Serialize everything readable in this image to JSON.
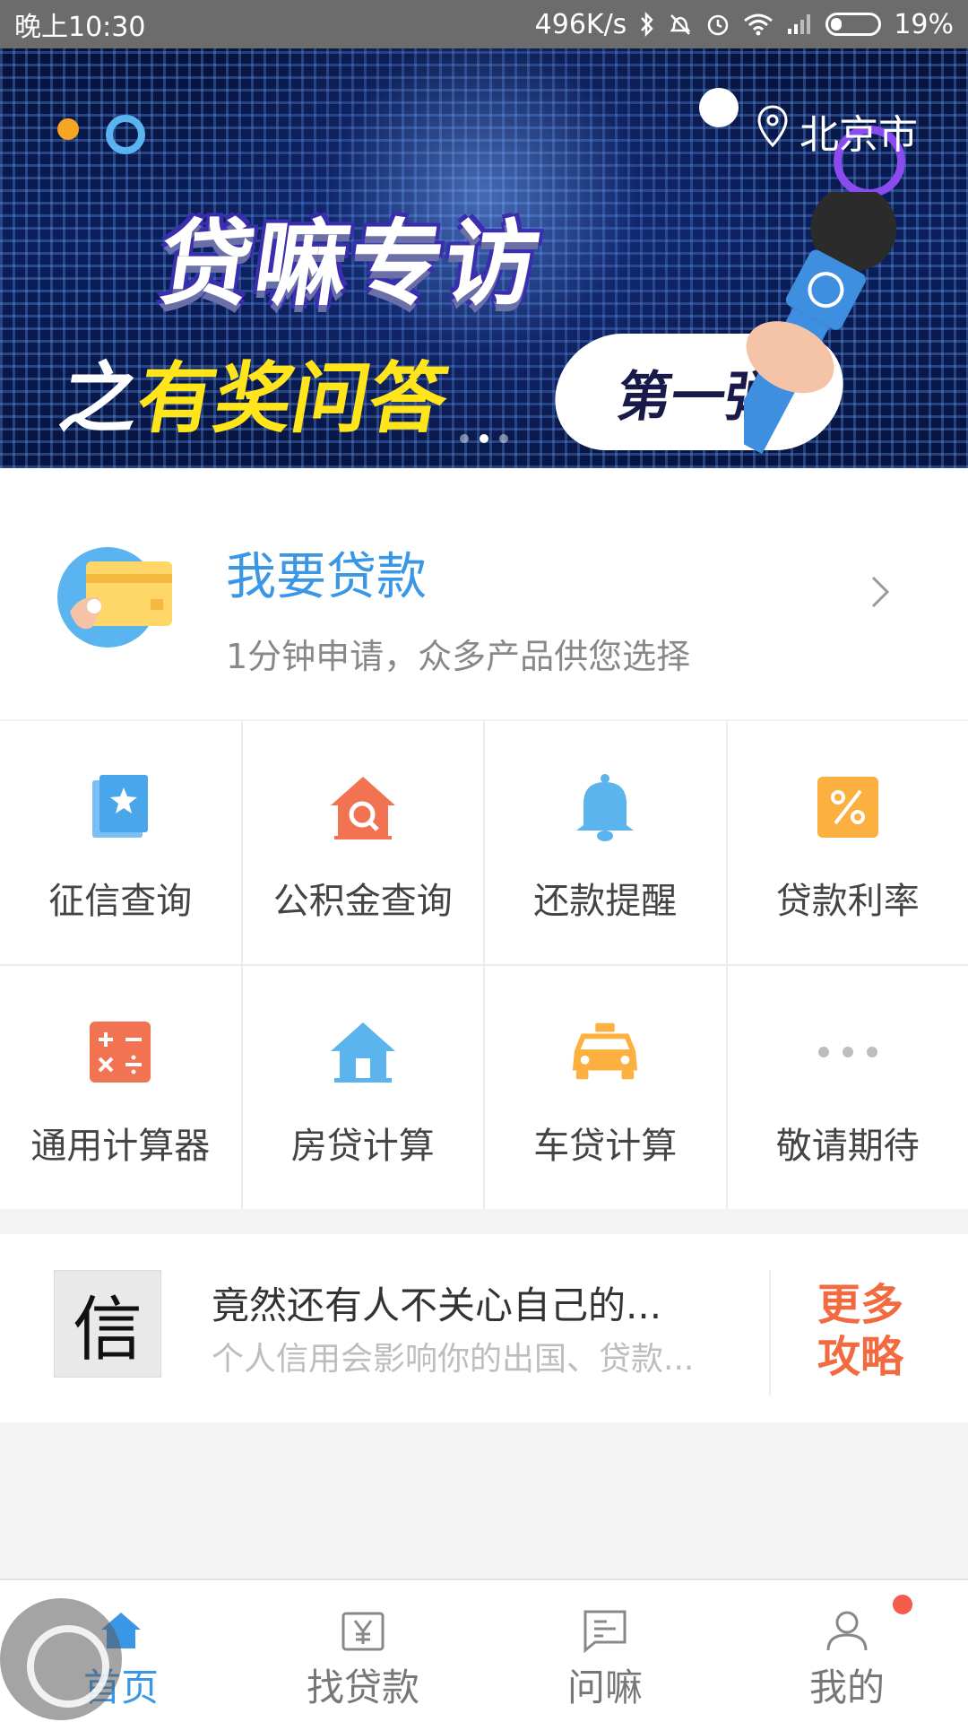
{
  "status_bar": {
    "time": "晚上10:30",
    "speed": "496K/s",
    "battery": "19%",
    "icons": [
      "bluetooth-icon",
      "mute-vibrate-icon",
      "alarm-icon",
      "wifi-icon",
      "signal-icon",
      "battery-icon"
    ]
  },
  "banner": {
    "location": "北京市",
    "title_line1": "贷嘛专访",
    "title_line2_prefix": "之",
    "title_line2_highlight": "有奖问答",
    "bubble_text": "第一弹",
    "pager_count": 3,
    "pager_active": 1
  },
  "loan_card": {
    "title": "我要贷款",
    "subtitle": "1分钟申请，众多产品供您选择"
  },
  "services": [
    {
      "label": "征信查询",
      "icon": "credit-report-icon",
      "color": "#4aa6ea"
    },
    {
      "label": "公积金查询",
      "icon": "house-search-icon",
      "color": "#f27351"
    },
    {
      "label": "还款提醒",
      "icon": "bell-icon",
      "color": "#5bb4ee"
    },
    {
      "label": "贷款利率",
      "icon": "percent-icon",
      "color": "#fbb03f"
    },
    {
      "label": "通用计算器",
      "icon": "calculator-icon",
      "color": "#f27351"
    },
    {
      "label": "房贷计算",
      "icon": "house-icon",
      "color": "#5bb4ee"
    },
    {
      "label": "车贷计算",
      "icon": "taxi-icon",
      "color": "#fbb03f"
    },
    {
      "label": "敬请期待",
      "icon": "more-dots-icon",
      "color": "#bdbdbd"
    }
  ],
  "article": {
    "thumb_char": "信",
    "title": "竟然还有人不关心自己的...",
    "subtitle": "个人信用会影响你的出国、贷款...",
    "more_line1": "更多",
    "more_line2": "攻略"
  },
  "tabbar": {
    "tabs": [
      {
        "label": "首页",
        "icon": "home-icon"
      },
      {
        "label": "找贷款",
        "icon": "yen-tag-icon"
      },
      {
        "label": "问嘛",
        "icon": "message-icon"
      },
      {
        "label": "我的",
        "icon": "user-icon"
      }
    ],
    "active_index": 0
  },
  "colors": {
    "accent_blue": "#3a97e6",
    "accent_orange": "#f26a3f",
    "badge_red": "#f55b4a"
  }
}
